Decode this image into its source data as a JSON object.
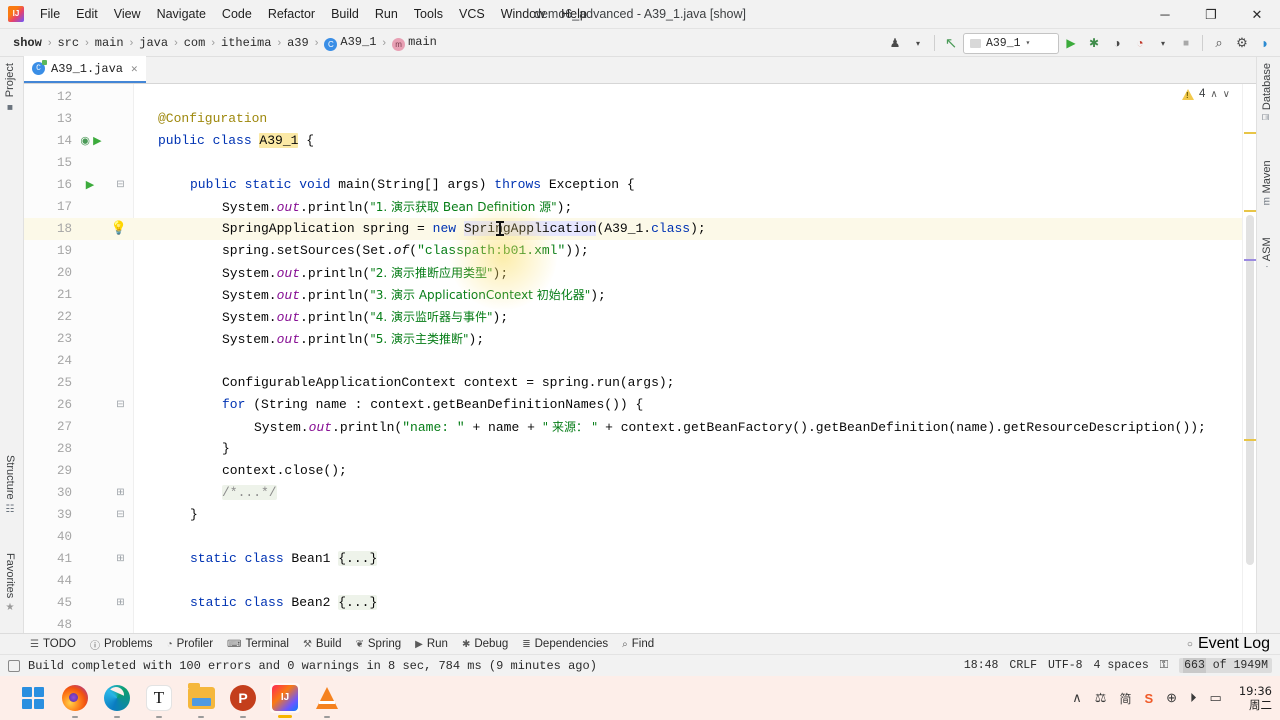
{
  "window": {
    "title": "demo6_advanced - A39_1.java [show]",
    "minimize": "─",
    "maximize": "❐",
    "close": "✕"
  },
  "menu": {
    "items": [
      "File",
      "Edit",
      "View",
      "Navigate",
      "Code",
      "Refactor",
      "Build",
      "Run",
      "Tools",
      "VCS",
      "Window",
      "Help"
    ]
  },
  "breadcrumb": {
    "items": [
      {
        "label": "show",
        "icon": "",
        "bold": true
      },
      {
        "label": "src",
        "icon": ""
      },
      {
        "label": "main",
        "icon": ""
      },
      {
        "label": "java",
        "icon": ""
      },
      {
        "label": "com",
        "icon": ""
      },
      {
        "label": "itheima",
        "icon": ""
      },
      {
        "label": "a39",
        "icon": ""
      },
      {
        "label": "A39_1",
        "icon": "class-icon",
        "glyph": "C"
      },
      {
        "label": "main",
        "icon": "method-icon",
        "glyph": "m"
      }
    ],
    "separator": "›"
  },
  "toolbar": {
    "vcs_user_label": "♟",
    "build_label": "↖",
    "run_config": "A39_1",
    "run_label": "▶",
    "debug_label": "✱",
    "run_coverage_label": "◑",
    "profile_label": "◔",
    "stop_label": "■",
    "search_label": "⌕",
    "settings_label": "⚙",
    "updates_label": "◗",
    "caret": "▾"
  },
  "editor_tabs": [
    {
      "label": "A39_1.java",
      "icon": "java-class-icon",
      "close": "✕",
      "active": true
    }
  ],
  "inspection": {
    "warning_count": "4",
    "up": "∧",
    "down": "∨"
  },
  "left_strip": [
    {
      "label": "Project",
      "icon": "folder-icon",
      "glyph": "■"
    },
    {
      "label": "Structure",
      "icon": "structure-icon",
      "glyph": "☷"
    },
    {
      "label": "Favorites",
      "icon": "star-icon",
      "glyph": "★"
    }
  ],
  "right_strip": [
    {
      "label": "Database",
      "icon": "database-icon",
      "glyph": "⌸"
    },
    {
      "label": "Maven",
      "icon": "maven-icon",
      "glyph": "m"
    },
    {
      "label": "ASM",
      "icon": "asm-icon",
      "glyph": "·"
    }
  ],
  "code": {
    "lines": [
      {
        "num": "12",
        "indent": 0,
        "tokens": [],
        "gutter": "",
        "fold": ""
      },
      {
        "num": "13",
        "indent": 0,
        "tokens": [
          {
            "t": "@Configuration",
            "c": "anno"
          }
        ],
        "gutter": "",
        "fold": ""
      },
      {
        "num": "14",
        "indent": 0,
        "tokens": [
          {
            "t": "public ",
            "c": "kw"
          },
          {
            "t": "class ",
            "c": "kw"
          },
          {
            "t": "A39_1",
            "c": "hl-id"
          },
          {
            "t": " {",
            "c": ""
          }
        ],
        "gutter": "bean-gutter-icon",
        "fold": ""
      },
      {
        "num": "15",
        "indent": 0,
        "tokens": [],
        "gutter": "",
        "fold": ""
      },
      {
        "num": "16",
        "indent": 1,
        "tokens": [
          {
            "t": "public ",
            "c": "kw"
          },
          {
            "t": "static ",
            "c": "kw"
          },
          {
            "t": "void ",
            "c": "kw"
          },
          {
            "t": "main(String[] args) ",
            "c": ""
          },
          {
            "t": "throws ",
            "c": "kw"
          },
          {
            "t": "Exception {",
            "c": ""
          }
        ],
        "gutter": "run-gutter-icon",
        "fold": "minus"
      },
      {
        "num": "17",
        "indent": 2,
        "tokens": [
          {
            "t": "System.",
            "c": ""
          },
          {
            "t": "out",
            "c": "fld"
          },
          {
            "t": ".println(",
            "c": ""
          },
          {
            "t": "\"1. 演示获取 Bean Definition 源\"",
            "c": "str"
          },
          {
            "t": ");",
            "c": ""
          }
        ],
        "gutter": "",
        "fold": ""
      },
      {
        "num": "18",
        "indent": 2,
        "tokens": [
          {
            "t": "SpringApplication spring = ",
            "c": ""
          },
          {
            "t": "new ",
            "c": "kw"
          },
          {
            "t": "SpringApplication",
            "c": "hl-wr"
          },
          {
            "t": "(A39_1.",
            "c": ""
          },
          {
            "t": "class",
            "c": "kw"
          },
          {
            "t": ");",
            "c": ""
          }
        ],
        "gutter": "bulb-gutter-icon",
        "fold": "",
        "active": true
      },
      {
        "num": "19",
        "indent": 2,
        "tokens": [
          {
            "t": "spring.setSources(Set.",
            "c": ""
          },
          {
            "t": "of",
            "c": "stat"
          },
          {
            "t": "(",
            "c": ""
          },
          {
            "t": "\"classpath:b01.xml\"",
            "c": "str"
          },
          {
            "t": "));",
            "c": ""
          }
        ],
        "gutter": "",
        "fold": ""
      },
      {
        "num": "20",
        "indent": 2,
        "tokens": [
          {
            "t": "System.",
            "c": ""
          },
          {
            "t": "out",
            "c": "fld"
          },
          {
            "t": ".println(",
            "c": ""
          },
          {
            "t": "\"2. 演示推断应用类型\"",
            "c": "str"
          },
          {
            "t": ");",
            "c": ""
          }
        ],
        "gutter": "",
        "fold": ""
      },
      {
        "num": "21",
        "indent": 2,
        "tokens": [
          {
            "t": "System.",
            "c": ""
          },
          {
            "t": "out",
            "c": "fld"
          },
          {
            "t": ".println(",
            "c": ""
          },
          {
            "t": "\"3. 演示 ApplicationContext 初始化器\"",
            "c": "str"
          },
          {
            "t": ");",
            "c": ""
          }
        ],
        "gutter": "",
        "fold": ""
      },
      {
        "num": "22",
        "indent": 2,
        "tokens": [
          {
            "t": "System.",
            "c": ""
          },
          {
            "t": "out",
            "c": "fld"
          },
          {
            "t": ".println(",
            "c": ""
          },
          {
            "t": "\"4. 演示监听器与事件\"",
            "c": "str"
          },
          {
            "t": ");",
            "c": ""
          }
        ],
        "gutter": "",
        "fold": ""
      },
      {
        "num": "23",
        "indent": 2,
        "tokens": [
          {
            "t": "System.",
            "c": ""
          },
          {
            "t": "out",
            "c": "fld"
          },
          {
            "t": ".println(",
            "c": ""
          },
          {
            "t": "\"5. 演示主类推断\"",
            "c": "str"
          },
          {
            "t": ");",
            "c": ""
          }
        ],
        "gutter": "",
        "fold": ""
      },
      {
        "num": "24",
        "indent": 0,
        "tokens": [],
        "gutter": "",
        "fold": ""
      },
      {
        "num": "25",
        "indent": 2,
        "tokens": [
          {
            "t": "ConfigurableApplicationContext context = spring.run(args);",
            "c": ""
          }
        ],
        "gutter": "",
        "fold": ""
      },
      {
        "num": "26",
        "indent": 2,
        "tokens": [
          {
            "t": "for ",
            "c": "kw"
          },
          {
            "t": "(String name : context.getBeanDefinitionNames()) {",
            "c": ""
          }
        ],
        "gutter": "",
        "fold": "minus"
      },
      {
        "num": "27",
        "indent": 3,
        "tokens": [
          {
            "t": "System.",
            "c": ""
          },
          {
            "t": "out",
            "c": "fld"
          },
          {
            "t": ".println(",
            "c": ""
          },
          {
            "t": "\"name: \"",
            "c": "str"
          },
          {
            "t": " + name + ",
            "c": ""
          },
          {
            "t": "\" 来源： \"",
            "c": "str"
          },
          {
            "t": " + context.getBeanFactory().getBeanDefinition(name).getResourceDescription());",
            "c": ""
          }
        ],
        "gutter": "",
        "fold": ""
      },
      {
        "num": "28",
        "indent": 2,
        "tokens": [
          {
            "t": "}",
            "c": ""
          }
        ],
        "gutter": "",
        "fold": ""
      },
      {
        "num": "29",
        "indent": 2,
        "tokens": [
          {
            "t": "context.close();",
            "c": ""
          }
        ],
        "gutter": "",
        "fold": ""
      },
      {
        "num": "30",
        "indent": 2,
        "tokens": [
          {
            "t": "/*...*/",
            "c": "cmt hl-fold"
          }
        ],
        "gutter": "",
        "fold": "plus"
      },
      {
        "num": "39",
        "indent": 1,
        "tokens": [
          {
            "t": "}",
            "c": ""
          }
        ],
        "gutter": "",
        "fold": "minus"
      },
      {
        "num": "40",
        "indent": 0,
        "tokens": [],
        "gutter": "",
        "fold": ""
      },
      {
        "num": "41",
        "indent": 1,
        "tokens": [
          {
            "t": "static ",
            "c": "kw"
          },
          {
            "t": "class ",
            "c": "kw"
          },
          {
            "t": "Bean1 ",
            "c": ""
          },
          {
            "t": "{...}",
            "c": "hl-fold"
          }
        ],
        "gutter": "",
        "fold": "plus"
      },
      {
        "num": "44",
        "indent": 0,
        "tokens": [],
        "gutter": "",
        "fold": ""
      },
      {
        "num": "45",
        "indent": 1,
        "tokens": [
          {
            "t": "static ",
            "c": "kw"
          },
          {
            "t": "class ",
            "c": "kw"
          },
          {
            "t": "Bean2 ",
            "c": ""
          },
          {
            "t": "{...}",
            "c": "hl-fold"
          }
        ],
        "gutter": "",
        "fold": "plus"
      },
      {
        "num": "48",
        "indent": 0,
        "tokens": [],
        "gutter": "",
        "fold": ""
      }
    ]
  },
  "tool_windows": [
    {
      "label": "TODO",
      "glyph": "☰"
    },
    {
      "label": "Problems",
      "glyph": "ⓘ"
    },
    {
      "label": "Profiler",
      "glyph": "◔"
    },
    {
      "label": "Terminal",
      "glyph": "⌨"
    },
    {
      "label": "Build",
      "glyph": "⚒"
    },
    {
      "label": "Spring",
      "glyph": "❦"
    },
    {
      "label": "Run",
      "glyph": "▶"
    },
    {
      "label": "Debug",
      "glyph": "✱"
    },
    {
      "label": "Dependencies",
      "glyph": "≣"
    },
    {
      "label": "Find",
      "glyph": "⌕"
    }
  ],
  "event_log": {
    "label": "Event Log",
    "glyph": "○"
  },
  "status": {
    "message": "Build completed with 100 errors and 0 warnings in 8 sec, 784 ms (9 minutes ago)",
    "time": "18:48",
    "line_separator": "CRLF",
    "encoding": "UTF-8",
    "indent": "4 spaces",
    "lock": "⚿",
    "memory_used": "663",
    "memory_of": "of",
    "memory_total": "1949M"
  },
  "taskbar": {
    "apps": [
      {
        "name": "start-button",
        "icon": "windows-icon",
        "running": false
      },
      {
        "name": "firefox",
        "icon": "firefox-icon",
        "running": false
      },
      {
        "name": "edge",
        "icon": "edge-icon",
        "running": false
      },
      {
        "name": "typora",
        "icon": "typora-icon",
        "running": false
      },
      {
        "name": "file-explorer",
        "icon": "folder-icon",
        "running": false
      },
      {
        "name": "powerpoint",
        "icon": "powerpoint-icon",
        "running": false
      },
      {
        "name": "intellij-idea",
        "icon": "intellij-icon",
        "running": true
      },
      {
        "name": "vlc",
        "icon": "vlc-icon",
        "running": false
      }
    ],
    "tray": [
      {
        "name": "show-hidden-icons",
        "glyph": "∧"
      },
      {
        "name": "microphone-icon",
        "glyph": "⚖"
      },
      {
        "name": "ime-icon",
        "glyph": "简"
      },
      {
        "name": "sogou-icon",
        "glyph": "S"
      },
      {
        "name": "network-icon",
        "glyph": "⊕"
      },
      {
        "name": "volume-icon",
        "glyph": "⏵"
      },
      {
        "name": "battery-icon",
        "glyph": "▭"
      }
    ],
    "clock_time": "19:36",
    "clock_day": "周二"
  },
  "colors": {
    "accent": "#4386d6",
    "keyword": "#0033b3",
    "string": "#067d17",
    "annotation": "#9e880d",
    "field": "#871094",
    "warning": "#f2c94c",
    "active_line": "#fcf9e8"
  }
}
